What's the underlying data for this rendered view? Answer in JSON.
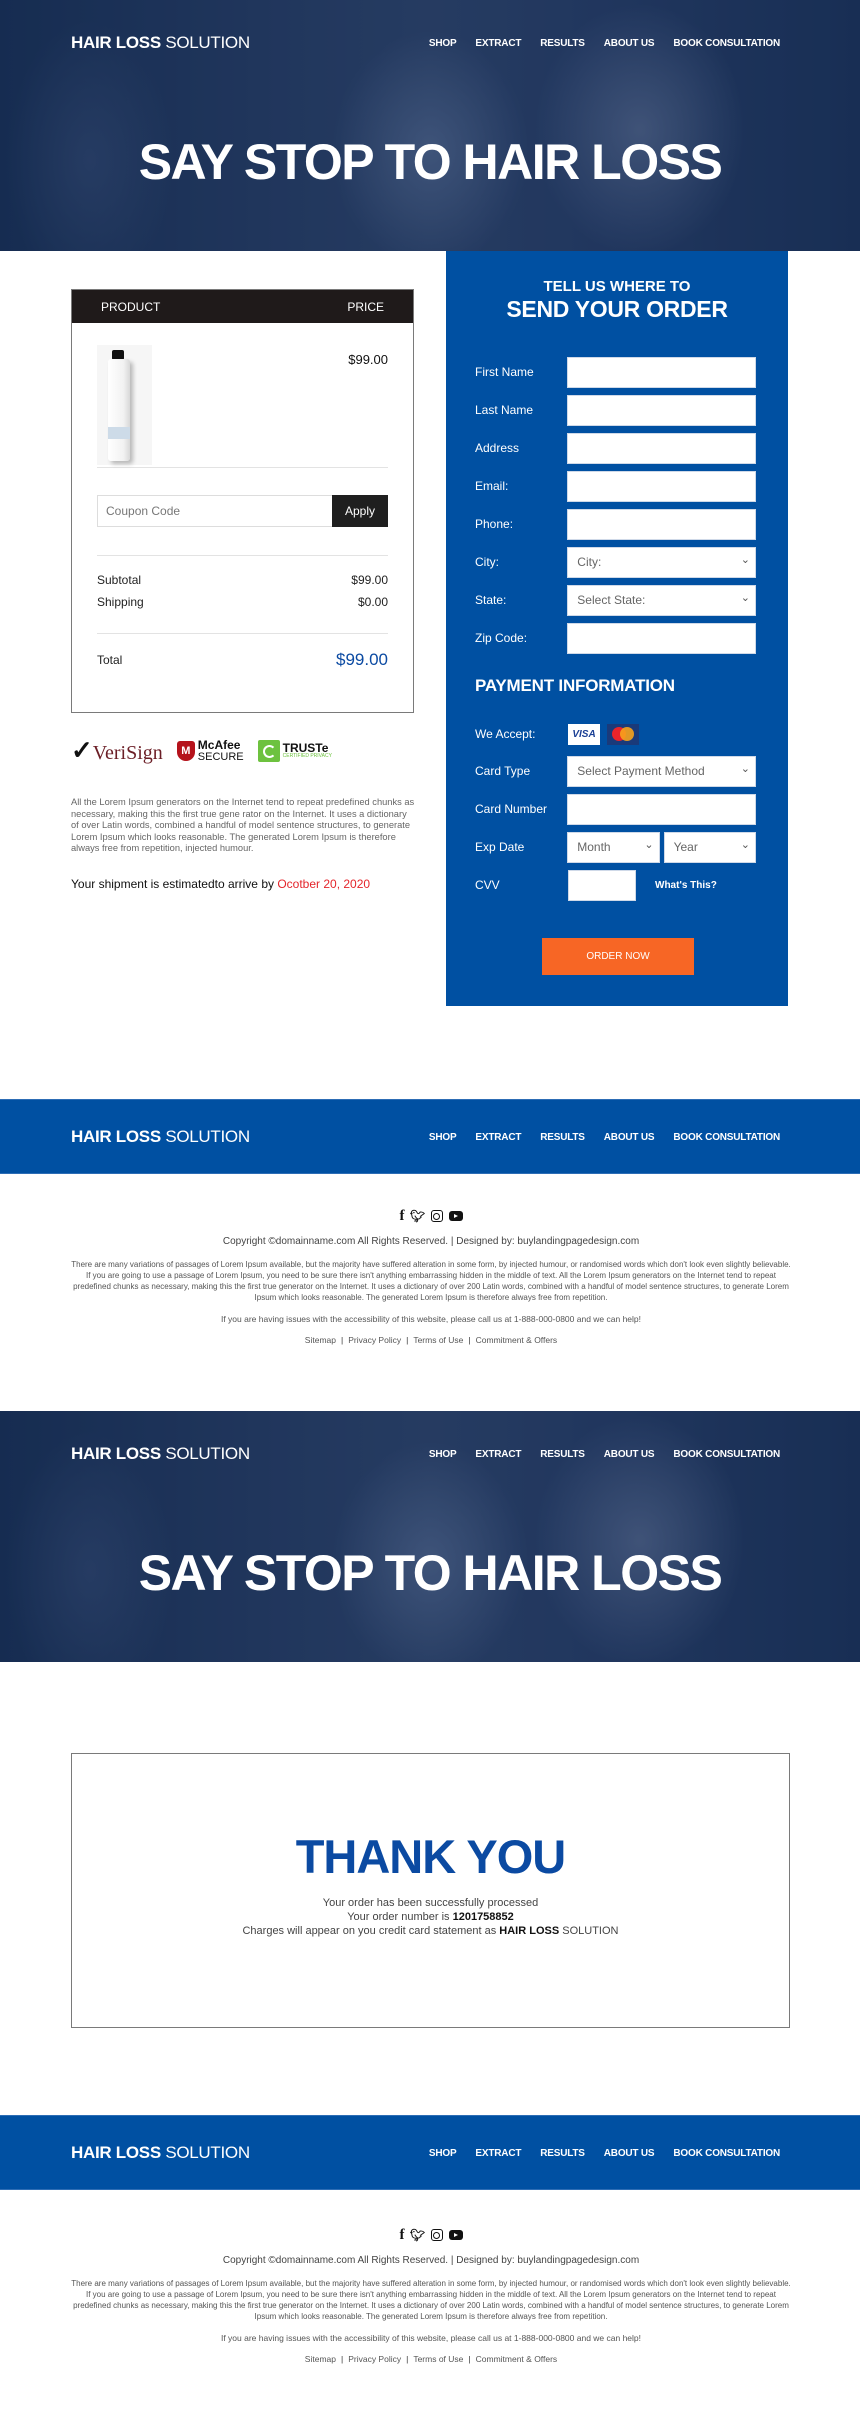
{
  "brand": {
    "bold": "HAIR LOSS",
    "light": "SOLUTION"
  },
  "nav": {
    "items": [
      "SHOP",
      "EXTRACT",
      "RESULTS",
      "ABOUT US",
      "BOOK CONSULTATION"
    ]
  },
  "hero": {
    "title": "SAY STOP TO HAIR LOSS"
  },
  "cart": {
    "header_product": "PRODUCT",
    "header_price": "PRICE",
    "item_price": "$99.00",
    "coupon_placeholder": "Coupon Code",
    "apply_label": "Apply",
    "subtotal_label": "Subtotal",
    "subtotal_value": "$99.00",
    "shipping_label": "Shipping",
    "shipping_value": "$0.00",
    "total_label": "Total",
    "total_value": "$99.00"
  },
  "trust_badges": {
    "verisign": "VeriSign",
    "mcafee_line1": "McAfee",
    "mcafee_line2": "SECURE",
    "truste_line1": "TRUSTe",
    "truste_line2": "CERTIFIED PRIVACY"
  },
  "disclaimer": "All the Lorem Ipsum generators on the Internet tend to repeat predefined chunks as necessary, making this the first true gene rator on the Internet. It uses a dictionary of over Latin words, combined a handful of model sentence structures, to generate Lorem Ipsum which looks reasonable. The generated Lorem Ipsum is therefore always free from repetition, injected humour.",
  "shipment": {
    "text": "Your shipment is estimatedto arrive by ",
    "date": "Ocotber 20, 2020"
  },
  "order_form": {
    "heading_top": "TELL US WHERE TO",
    "heading_main": "SEND YOUR ORDER",
    "fields": {
      "first_name": "First Name",
      "last_name": "Last Name",
      "address": "Address",
      "email": "Email:",
      "phone": "Phone:",
      "city": "City:",
      "city_select": "City:",
      "state": "State:",
      "state_select": "Select State:",
      "zip": "Zip Code:"
    },
    "payment": {
      "heading": "PAYMENT INFORMATION",
      "we_accept": "We Accept:",
      "visa": "VISA",
      "card_type": "Card Type",
      "card_type_select": "Select Payment Method",
      "card_number": "Card Number",
      "exp_date": "Exp Date",
      "month_select": "Month",
      "year_select": "Year",
      "cvv": "CVV",
      "whats_this": "What's This?"
    },
    "submit_label": "ORDER NOW"
  },
  "footer": {
    "copyright": "Copyright ©domainname.com All Rights Reserved. | Designed by: buylandingpagedesign.com",
    "text": "There are many variations of passages of Lorem Ipsum available, but the majority have suffered alteration in some form, by injected humour, or randomised words which don't look even slightly believable. If you are going to use a passage of Lorem Ipsum, you need to be sure there isn't anything embarrassing hidden in the middle of text. All the Lorem Ipsum generators on the Internet tend to repeat predefined chunks as necessary, making this the first true generator on the Internet. It uses a dictionary of over 200 Latin words, combined with a handful of model sentence structures, to generate Lorem Ipsum which looks reasonable. The generated Lorem Ipsum is therefore always free from repetition.",
    "accessibility": "If you are having issues with the accessibility of this website, please call us at 1-888-000-0800 and we can help!",
    "links": [
      "Sitemap",
      "Privacy Policy",
      "Terms of Use",
      "Commitment & Offers"
    ],
    "social_icons": [
      "facebook-icon",
      "twitter-icon",
      "instagram-icon",
      "youtube-icon"
    ]
  },
  "thank_you": {
    "title": "THANK YOU",
    "line1": "Your order has been successfully processed",
    "line2_prefix": "Your order number is ",
    "order_number": "1201758852",
    "line3_prefix": "Charges will appear on you credit card statement as ",
    "statement_bold": "HAIR LOSS",
    "statement_light": " SOLUTION"
  },
  "colors": {
    "brand_blue": "#0050a2",
    "accent_orange": "#f76625",
    "total_blue": "#0b4aa2",
    "date_red": "#e4252b",
    "dark": "#1f1a1a"
  }
}
